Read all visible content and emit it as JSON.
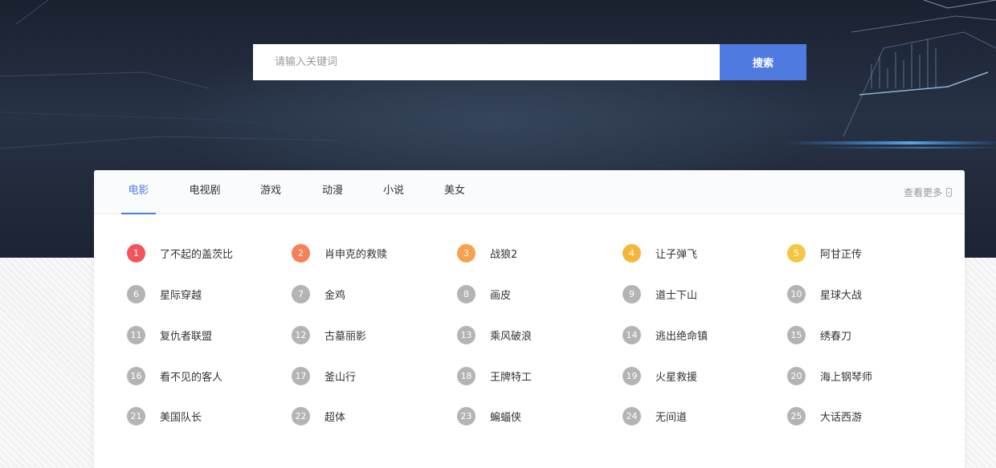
{
  "search": {
    "placeholder": "请输入关键词",
    "button_label": "搜索"
  },
  "tabs": [
    {
      "label": "电影",
      "active": true
    },
    {
      "label": "电视剧",
      "active": false
    },
    {
      "label": "游戏",
      "active": false
    },
    {
      "label": "动漫",
      "active": false
    },
    {
      "label": "小说",
      "active": false
    },
    {
      "label": "美女",
      "active": false
    }
  ],
  "more_label": "查看更多",
  "colors": {
    "accent": "#4f7be0",
    "rank1": "#f5535c",
    "rank2": "#f5805a",
    "rank3": "#f5a24d",
    "rank4": "#f5b73b",
    "rank5": "#f5c640",
    "rank_default": "#b4b4b4"
  },
  "rankings": [
    {
      "rank": "1",
      "title": "了不起的盖茨比"
    },
    {
      "rank": "2",
      "title": "肖申克的救赎"
    },
    {
      "rank": "3",
      "title": "战狼2"
    },
    {
      "rank": "4",
      "title": "让子弹飞"
    },
    {
      "rank": "5",
      "title": "阿甘正传"
    },
    {
      "rank": "6",
      "title": "星际穿越"
    },
    {
      "rank": "7",
      "title": "金鸡"
    },
    {
      "rank": "8",
      "title": "画皮"
    },
    {
      "rank": "9",
      "title": "道士下山"
    },
    {
      "rank": "10",
      "title": "星球大战"
    },
    {
      "rank": "11",
      "title": "复仇者联盟"
    },
    {
      "rank": "12",
      "title": "古墓丽影"
    },
    {
      "rank": "13",
      "title": "乘风破浪"
    },
    {
      "rank": "14",
      "title": "逃出绝命镇"
    },
    {
      "rank": "15",
      "title": "绣春刀"
    },
    {
      "rank": "16",
      "title": "看不见的客人"
    },
    {
      "rank": "17",
      "title": "釜山行"
    },
    {
      "rank": "18",
      "title": "王牌特工"
    },
    {
      "rank": "19",
      "title": "火星救援"
    },
    {
      "rank": "20",
      "title": "海上钢琴师"
    },
    {
      "rank": "21",
      "title": "美国队长"
    },
    {
      "rank": "22",
      "title": "超体"
    },
    {
      "rank": "23",
      "title": "蝙蝠侠"
    },
    {
      "rank": "24",
      "title": "无间道"
    },
    {
      "rank": "25",
      "title": "大话西游"
    }
  ]
}
